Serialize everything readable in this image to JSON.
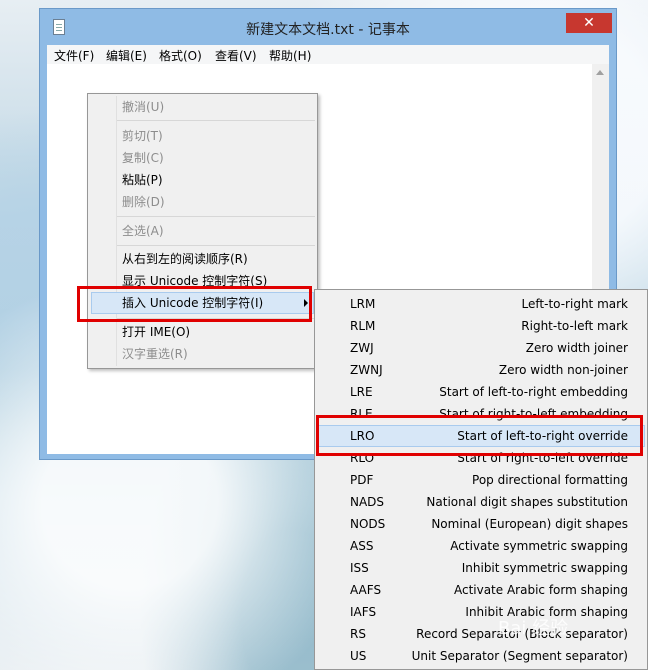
{
  "window": {
    "title": "新建文本文档.txt - 记事本",
    "close_glyph": "✕"
  },
  "menubar": {
    "items": [
      "文件(F)",
      "编辑(E)",
      "格式(O)",
      "查看(V)",
      "帮助(H)"
    ]
  },
  "context_menu": {
    "undo": "撤消(U)",
    "cut": "剪切(T)",
    "copy": "复制(C)",
    "paste": "粘贴(P)",
    "delete": "删除(D)",
    "select_all": "全选(A)",
    "rtl_order": "从右到左的阅读顺序(R)",
    "show_unicode": "显示 Unicode 控制字符(S)",
    "insert_unicode": "插入 Unicode 控制字符(I)",
    "open_ime": "打开 IME(O)",
    "reconversion": "汉字重选(R)"
  },
  "submenu": {
    "rows": [
      {
        "code": "LRM",
        "desc": "Left-to-right mark"
      },
      {
        "code": "RLM",
        "desc": "Right-to-left mark"
      },
      {
        "code": "ZWJ",
        "desc": "Zero width joiner"
      },
      {
        "code": "ZWNJ",
        "desc": "Zero width non-joiner"
      },
      {
        "code": "LRE",
        "desc": "Start of left-to-right embedding"
      },
      {
        "code": "RLE",
        "desc": "Start of right-to-left embedding"
      },
      {
        "code": "LRO",
        "desc": "Start of left-to-right override"
      },
      {
        "code": "RLO",
        "desc": "Start of right-to-left override"
      },
      {
        "code": "PDF",
        "desc": "Pop directional formatting"
      },
      {
        "code": "NADS",
        "desc": "National digit shapes substitution"
      },
      {
        "code": "NODS",
        "desc": "Nominal (European) digit shapes"
      },
      {
        "code": "ASS",
        "desc": "Activate symmetric swapping"
      },
      {
        "code": "ISS",
        "desc": "Inhibit symmetric swapping"
      },
      {
        "code": "AAFS",
        "desc": "Activate Arabic form shaping"
      },
      {
        "code": "IAFS",
        "desc": "Inhibit Arabic form shaping"
      },
      {
        "code": "RS",
        "desc": "Record Separator (Block separator)"
      },
      {
        "code": "US",
        "desc": "Unit Separator (Segment separator)"
      }
    ]
  },
  "watermark": "Bai 经验"
}
